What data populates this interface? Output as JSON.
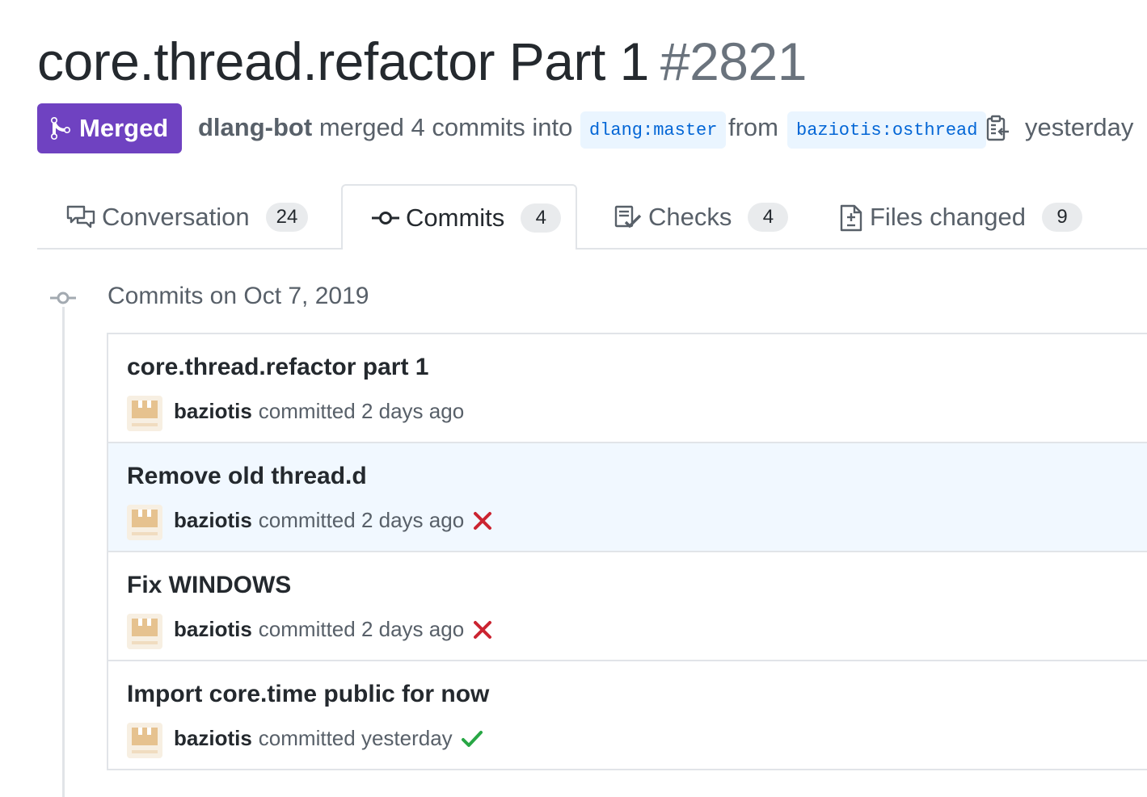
{
  "pr": {
    "title": "core.thread.refactor Part 1",
    "number": "#2821",
    "state": "Merged",
    "author": "dlang-bot",
    "action_text": "merged 4 commits into",
    "base_branch": "dlang:master",
    "from_text": "from",
    "head_branch": "baziotis:osthread",
    "time": "yesterday"
  },
  "tabs": [
    {
      "label": "Conversation",
      "count": "24",
      "icon": "comment-discussion-icon",
      "selected": false
    },
    {
      "label": "Commits",
      "count": "4",
      "icon": "git-commit-icon",
      "selected": true
    },
    {
      "label": "Checks",
      "count": "4",
      "icon": "checklist-icon",
      "selected": false
    },
    {
      "label": "Files changed",
      "count": "9",
      "icon": "file-diff-icon",
      "selected": false
    }
  ],
  "timeline": {
    "date_label": "Commits on Oct 7, 2019",
    "commits": [
      {
        "message": "core.thread.refactor part 1",
        "author": "baziotis",
        "meta": "committed 2 days ago",
        "status": "none"
      },
      {
        "message": "Remove old thread.d",
        "author": "baziotis",
        "meta": "committed 2 days ago",
        "status": "failure"
      },
      {
        "message": "Fix WINDOWS",
        "author": "baziotis",
        "meta": "committed 2 days ago",
        "status": "failure"
      },
      {
        "message": "Import core.time public for now",
        "author": "baziotis",
        "meta": "committed yesterday",
        "status": "success"
      }
    ]
  },
  "colors": {
    "merged": "#6f42c1",
    "failure": "#cb2431",
    "success": "#28a745",
    "branch_bg": "#eaf5ff",
    "branch_text": "#0366d6",
    "highlight_row": "#f1f8ff"
  }
}
